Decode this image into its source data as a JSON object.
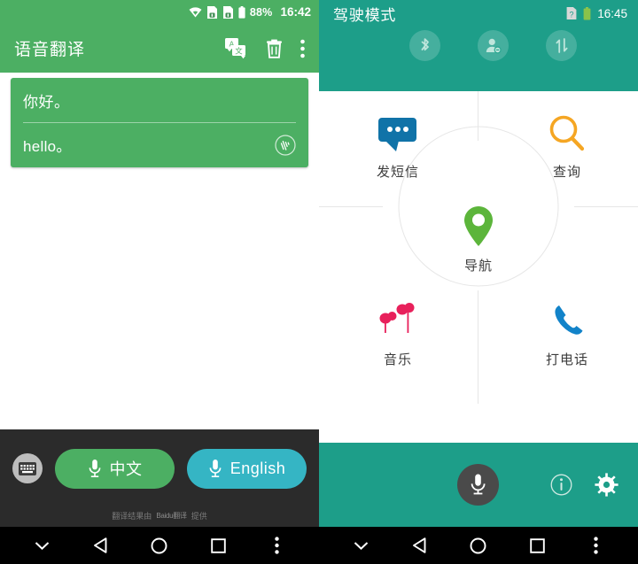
{
  "left_phone": {
    "status_bar": {
      "icons": [
        "wifi-icon",
        "sim-card-1-icon",
        "sim-card-2-icon",
        "battery-icon"
      ],
      "battery_percent": "88%",
      "time": "16:42"
    },
    "app_bar": {
      "title": "语音翻译",
      "actions": [
        "translate-language-icon",
        "delete-icon",
        "overflow-menu-icon"
      ]
    },
    "translation_card": {
      "source_text": "你好。",
      "translated_text": "hello。",
      "speaker_icon": "speaker-play-icon"
    },
    "controls": {
      "keyboard_icon": "keyboard-icon",
      "buttons": [
        {
          "label": "中文",
          "icon": "microphone-icon",
          "color": "#4CAF63"
        },
        {
          "label": "English",
          "icon": "microphone-icon",
          "color": "#35B5C4"
        }
      ],
      "attribution_prefix": "翻译结果由",
      "attribution_brand": "Baidu翻译",
      "attribution_suffix": "提供"
    },
    "nav_bar": [
      "chevron-down-icon",
      "back-icon",
      "home-icon",
      "recents-icon",
      "overflow-menu-icon"
    ]
  },
  "right_phone": {
    "status_bar": {
      "title": "驾驶模式",
      "icons": [
        "sim-unknown-icon",
        "battery-icon"
      ],
      "time": "16:45"
    },
    "toggles": [
      "bluetooth-icon",
      "contacts-icon",
      "data-transfer-icon"
    ],
    "grid": [
      {
        "label": "发短信",
        "icon": "message-bubble-icon",
        "color": "#1073A8",
        "pos": "top-left"
      },
      {
        "label": "查询",
        "icon": "search-magnifier-icon",
        "color": "#F5A623",
        "pos": "top-right"
      },
      {
        "label": "导航",
        "icon": "map-pin-icon",
        "color": "#5CB53B",
        "pos": "center"
      },
      {
        "label": "音乐",
        "icon": "earbuds-icon",
        "color": "#E8205B",
        "pos": "bottom-left"
      },
      {
        "label": "打电话",
        "icon": "phone-handset-icon",
        "color": "#1283C9",
        "pos": "bottom-right"
      }
    ],
    "bottom_bar": {
      "mic_icon": "microphone-icon",
      "info_icon": "info-icon",
      "settings_icon": "gear-icon"
    },
    "nav_bar": [
      "chevron-down-icon",
      "back-icon",
      "home-icon",
      "recents-icon",
      "overflow-menu-icon"
    ]
  },
  "colors": {
    "left_green": "#4CAF63",
    "right_teal": "#1D9E89",
    "dark_panel": "#2b2b2b",
    "nav_black": "#000000"
  }
}
